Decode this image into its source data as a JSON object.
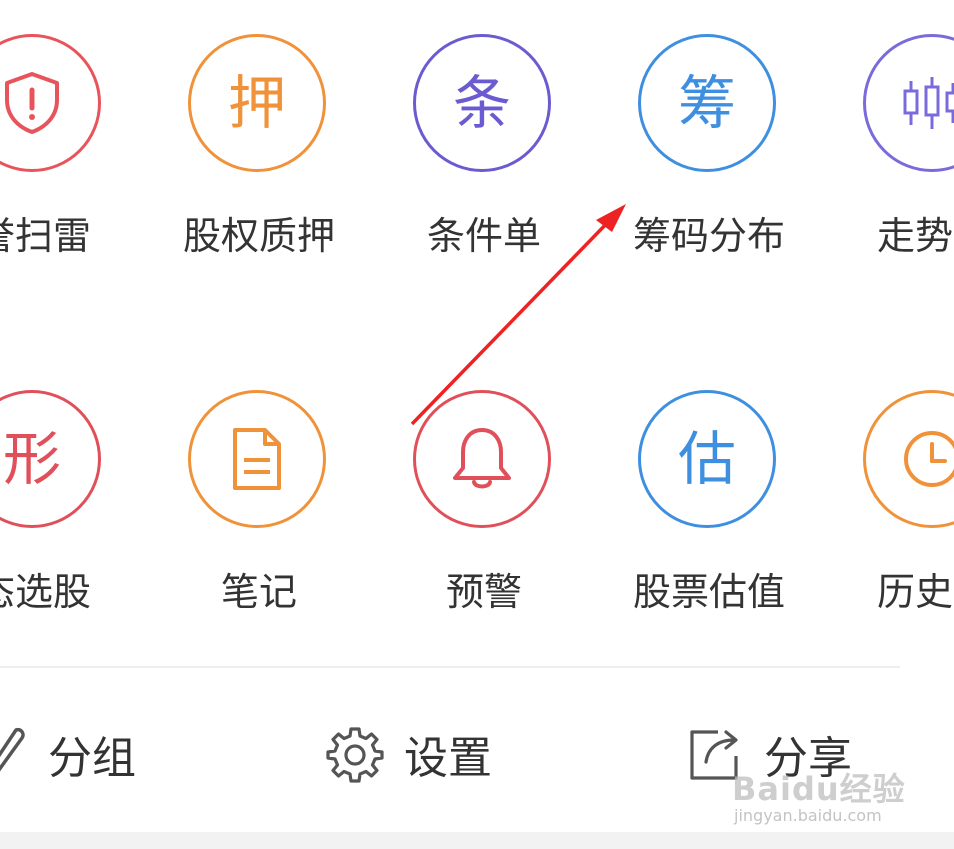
{
  "grid": {
    "row1": [
      {
        "label": "誉扫雷",
        "glyph": "",
        "icon": "shield-alert-icon",
        "color": "#e8545c"
      },
      {
        "label": "股权质押",
        "glyph": "押",
        "icon": "pledge-char-icon",
        "color": "#f0923a"
      },
      {
        "label": "条件单",
        "glyph": "条",
        "icon": "condition-char-icon",
        "color": "#6a5bd0"
      },
      {
        "label": "筹码分布",
        "glyph": "筹",
        "icon": "chips-char-icon",
        "color": "#3f8fe0"
      },
      {
        "label": "走势预",
        "glyph": "",
        "icon": "candlestick-icon",
        "color": "#7a6bdc"
      }
    ],
    "row2": [
      {
        "label": "态选股",
        "glyph": "形",
        "icon": "pattern-char-icon",
        "color": "#e0505a"
      },
      {
        "label": "笔记",
        "glyph": "",
        "icon": "document-icon",
        "color": "#f0923a"
      },
      {
        "label": "预警",
        "glyph": "",
        "icon": "bell-icon",
        "color": "#e0505a"
      },
      {
        "label": "股票估值",
        "glyph": "估",
        "icon": "valuation-char-icon",
        "color": "#3f8fe0"
      },
      {
        "label": "历史回",
        "glyph": "",
        "icon": "clock-icon",
        "color": "#f0923a"
      }
    ]
  },
  "bottom": {
    "group_label": "分组",
    "settings_label": "设置",
    "share_label": "分享"
  },
  "watermark": {
    "brand": "Baidu经验",
    "url": "jingyan.baidu.com"
  },
  "annotation": {
    "arrow_color": "#ee2222"
  }
}
